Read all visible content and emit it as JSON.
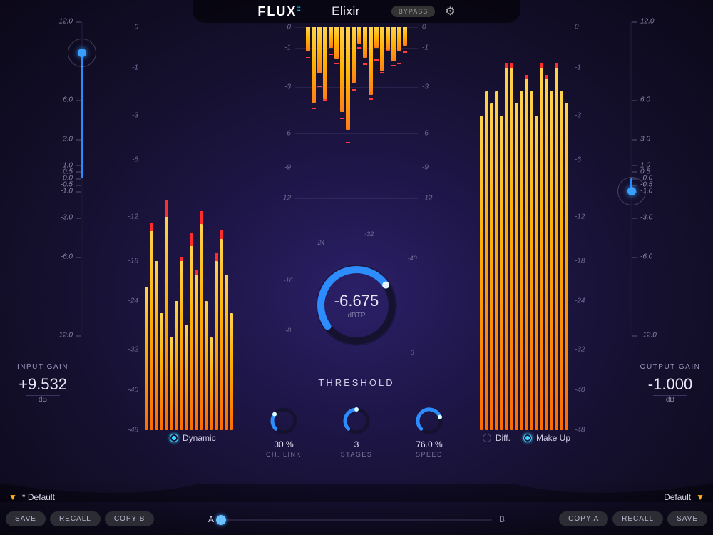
{
  "brand": "FLUX",
  "product": "Elixir",
  "bypass_label": "BYPASS",
  "input_gain": {
    "label": "INPUT GAIN",
    "value": "+9.532",
    "unit": "dB",
    "slider_pct": 10
  },
  "output_gain": {
    "label": "OUTPUT GAIN",
    "value": "-1.000",
    "unit": "dB",
    "slider_pct": 54
  },
  "gain_scale": [
    {
      "v": "12.0",
      "p": 0
    },
    {
      "v": "6.0",
      "p": 25
    },
    {
      "v": "3.0",
      "p": 37.5
    },
    {
      "v": "1.0",
      "p": 45.8
    },
    {
      "v": "0.5",
      "p": 47.9
    },
    {
      "v": "-0.0",
      "p": 50
    },
    {
      "v": "-0.5",
      "p": 52.1
    },
    {
      "v": "-1.0",
      "p": 54.2
    },
    {
      "v": "-3.0",
      "p": 62.5
    },
    {
      "v": "-6.0",
      "p": 75
    },
    {
      "v": "-12.0",
      "p": 100
    }
  ],
  "meter_scale": [
    {
      "v": "0",
      "p": 0
    },
    {
      "v": "-1",
      "p": 10
    },
    {
      "v": "-3",
      "p": 22
    },
    {
      "v": "-6",
      "p": 33
    },
    {
      "v": "-12",
      "p": 47
    },
    {
      "v": "-18",
      "p": 58
    },
    {
      "v": "-24",
      "p": 68
    },
    {
      "v": "-32",
      "p": 80
    },
    {
      "v": "-40",
      "p": 90
    },
    {
      "v": "-48",
      "p": 100
    }
  ],
  "gr_scale": [
    {
      "v": "0",
      "p": 0
    },
    {
      "v": "-1",
      "p": 12
    },
    {
      "v": "-3",
      "p": 35
    },
    {
      "v": "-6",
      "p": 62
    },
    {
      "v": "-9",
      "p": 82
    },
    {
      "v": "-12",
      "p": 100
    }
  ],
  "threshold": {
    "label": "THRESHOLD",
    "value": "-6.675",
    "unit": "dBTP",
    "arc_pct": 0.72
  },
  "thresh_ticks": [
    "-8",
    "-16",
    "-24",
    "-32",
    "-40",
    "0"
  ],
  "knobs": {
    "ch_link": {
      "label": "CH. LINK",
      "value": "30 %",
      "pct": 0.3
    },
    "stages": {
      "label": "STAGES",
      "value": "3",
      "pct": 0.5
    },
    "speed": {
      "label": "SPEED",
      "value": "76.0 %",
      "pct": 0.76
    }
  },
  "toggles": {
    "dynamic": {
      "label": "Dynamic",
      "on": true
    },
    "diff": {
      "label": "Diff.",
      "on": false
    },
    "makeup": {
      "label": "Make Up",
      "on": true
    }
  },
  "footer": {
    "preset_a": "* Default",
    "preset_b": "Default",
    "buttons_l": [
      "SAVE",
      "RECALL",
      "COPY B"
    ],
    "buttons_r": [
      "COPY A",
      "RECALL",
      "SAVE"
    ],
    "ab": {
      "a": "A",
      "b": "B",
      "pos": 0
    }
  },
  "chart_data": {
    "type": "bar",
    "input_meter_db": [
      -22,
      -14,
      -18,
      -26,
      -12,
      -30,
      -24,
      -18,
      -28,
      -16,
      -20,
      -13,
      -24,
      -30,
      -18,
      -15,
      -20,
      -26
    ],
    "input_peak_db": [
      0,
      2,
      0,
      0,
      4,
      0,
      0,
      1,
      0,
      3,
      1,
      3,
      0,
      0,
      2,
      2,
      0,
      0
    ],
    "output_meter_db": [
      -3,
      -2,
      -2.5,
      -2,
      -3,
      -1,
      -1,
      -2.5,
      -2,
      -1.5,
      -2,
      -3,
      -1,
      -1.5,
      -2,
      -1,
      -2,
      -2.5
    ],
    "gr_db": [
      1.2,
      4.0,
      2.3,
      3.8,
      1.0,
      1.6,
      4.6,
      5.8,
      2.8,
      0.8,
      1.5,
      3.5,
      1.0,
      2.2,
      1.1,
      1.7,
      1.2,
      0.9
    ]
  }
}
